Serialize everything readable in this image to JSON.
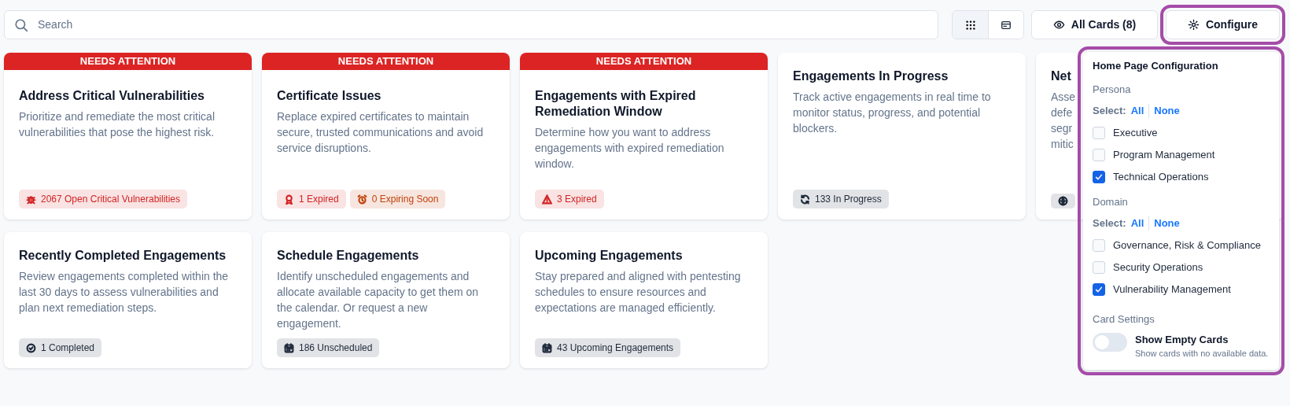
{
  "search": {
    "placeholder": "Search"
  },
  "view_modes": [
    {
      "selected": true
    },
    {
      "selected": false
    }
  ],
  "all_cards_button": {
    "label": "All Cards (8)"
  },
  "configure_button": {
    "label": "Configure",
    "highlighted": true
  },
  "cards": [
    {
      "banner": "NEEDS ATTENTION",
      "title": "Address Critical Vulnerabilities",
      "description": [
        "Prioritize and remediate the most critical vulnerabilities that pose the highest risk."
      ],
      "badges": [
        {
          "label": "2067 Open Critical Vulnerabilities",
          "color": "#d32424"
        }
      ]
    },
    {
      "banner": "NEEDS ATTENTION",
      "title": "Certificate Issues",
      "description": [
        "Replace expired certificates to maintain secure, trusted communications and avoid service disruptions."
      ],
      "badges": [
        {
          "label": "1 Expired",
          "color": "#d32424"
        },
        {
          "label": "0 Expiring Soon",
          "color": "#c2410c"
        }
      ]
    },
    {
      "banner": "NEEDS ATTENTION",
      "title": "Engagements with Expired Remediation Window",
      "description": [
        "Determine how you want to address engagements with expired remediation window."
      ],
      "badges": [
        {
          "label": "3 Expired",
          "color": "#d32424"
        }
      ]
    },
    {
      "title": "Engagements In Progress",
      "description": [
        "Track active engagements in real time to monitor status, progress, and potential blockers."
      ],
      "badges": [
        {
          "label": "133 In Progress",
          "color": "#1e293b"
        }
      ]
    },
    {
      "title": "Net",
      "description": [
        "Asse",
        "defe",
        "segr",
        "mitic"
      ],
      "badges": [
        {
          "color": "#1e293b"
        }
      ]
    },
    {
      "title": "Recently Completed Engagements",
      "description": [
        "Review engagements completed within the last 30 days to assess vulnerabilities and plan next remediation steps."
      ],
      "badges": [
        {
          "label": "1 Completed",
          "color": "#1e293b"
        }
      ]
    },
    {
      "title": "Schedule Engagements",
      "description": [
        "Identify unscheduled engagements and allocate available capacity to get them on the calendar. Or request a new engagement."
      ],
      "badges": [
        {
          "label": "186 Unscheduled",
          "color": "#1e293b"
        }
      ]
    },
    {
      "title": "Upcoming Engagements",
      "description": [
        "Stay prepared and aligned with pentesting schedules to ensure resources and expectations are managed efficiently."
      ],
      "badges": [
        {
          "label": "43 Upcoming Engagements",
          "color": "#1e293b"
        }
      ]
    }
  ],
  "configuration": {
    "title": "Home Page Configuration",
    "highlighted": true,
    "sections": [
      {
        "heading": "Persona",
        "select_label": "Select:",
        "all": "All",
        "none": "None",
        "options": [
          {
            "label": "Executive",
            "checked": false
          },
          {
            "label": "Program Management",
            "checked": false
          },
          {
            "label": "Technical Operations",
            "checked": true
          }
        ]
      },
      {
        "heading": "Domain",
        "select_label": "Select:",
        "all": "All",
        "none": "None",
        "options": [
          {
            "label": "Governance, Risk & Compliance",
            "checked": false
          },
          {
            "label": "Security Operations",
            "checked": false
          },
          {
            "label": "Vulnerability Management",
            "checked": true
          }
        ]
      }
    ],
    "card_settings": {
      "heading": "Card Settings",
      "toggle": {
        "label": "Show Empty Cards",
        "hint": "Show cards with no available data.",
        "on": false
      }
    }
  }
}
